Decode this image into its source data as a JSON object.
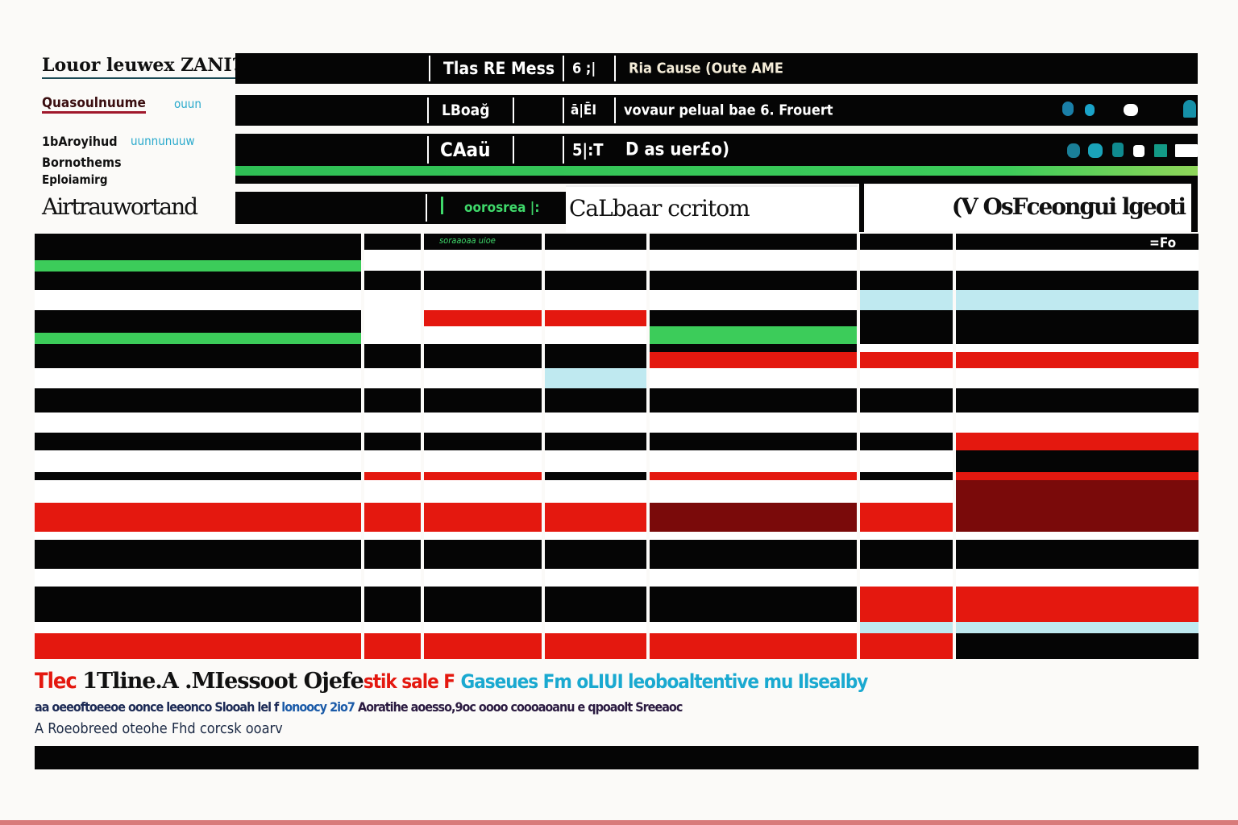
{
  "sidebar": {
    "labels": [
      "Louor leuwex ZANI?",
      "Quasoulnuume",
      "1bAroyihud",
      "Bornothems",
      "Eploiamirg",
      "Airtrauwortand"
    ],
    "sub_labels": [
      "ouun",
      "uunnunuuw"
    ]
  },
  "header": {
    "rows": [
      {
        "col1": "Tlas RE Mess",
        "col2": "6 ;|",
        "col3": "Ria Cause (Oute AME"
      },
      {
        "col1": "LBoağ",
        "col2": "ā|ĒI",
        "col3": "vovaur pelual bae 6. Frouert"
      },
      {
        "col1": "CAaü",
        "col2": "5|:T",
        "col3": "D as uer£o)"
      }
    ],
    "status_badge": "oorosrea |:",
    "column_title_1": "CaLbaar ccritom",
    "column_title_2": "(V OsFceongui lgeoti",
    "small_caption": "soraaoaa uioe",
    "corner_label": "=Fo"
  },
  "colors": {
    "black": "#050505",
    "white": "#ffffff",
    "red": "#e4180f",
    "dark_red": "#7a0a0a",
    "green": "#3ccc5a",
    "cyan": "#bfe9f0",
    "teal": "#1590a8"
  },
  "footer": {
    "title_red": "Tlec",
    "title_black": "1Tline.A .MIessoot Ojefe",
    "title_red2": "stik sale F",
    "title_cyan": "Gaseues Fm oLIUI leoboaltentive mu Ilsealby",
    "line2_dark": "aa oeeoftoeeoe oonce leeonco Slooah lel f",
    "line2_blue": "lonoocy 2io7",
    "line2_rest": "Aoratihe aoesso,9oc oooo coooaoanu e qpoaolt Sreeaoc",
    "line3": "A Roeobreed oteohe Fhd corcsk ooarv"
  }
}
